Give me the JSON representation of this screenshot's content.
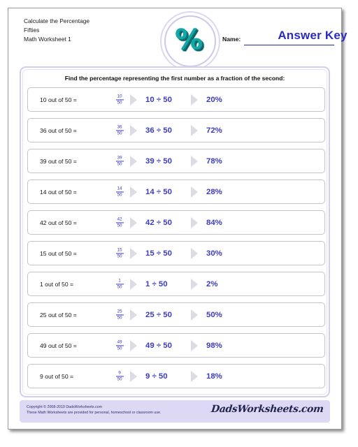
{
  "header": {
    "title_lines": [
      "Calculate the Percentage",
      "Fifties",
      "Math Worksheet 1"
    ],
    "logo_symbol": "%",
    "name_label": "Name:",
    "name_value": "Answer Key"
  },
  "worksheet": {
    "instructions": "Find the percentage representing the first number as a fraction of the second:",
    "problems": [
      {
        "prompt": "10 out of 50 =",
        "numerator": "10",
        "denominator": "50",
        "expression": "10 ÷ 50",
        "answer": "20%"
      },
      {
        "prompt": "36 out of 50 =",
        "numerator": "36",
        "denominator": "50",
        "expression": "36 ÷ 50",
        "answer": "72%"
      },
      {
        "prompt": "39 out of 50 =",
        "numerator": "39",
        "denominator": "50",
        "expression": "39 ÷ 50",
        "answer": "78%"
      },
      {
        "prompt": "14 out of 50 =",
        "numerator": "14",
        "denominator": "50",
        "expression": "14 ÷ 50",
        "answer": "28%"
      },
      {
        "prompt": "42 out of 50 =",
        "numerator": "42",
        "denominator": "50",
        "expression": "42 ÷ 50",
        "answer": "84%"
      },
      {
        "prompt": "15 out of 50 =",
        "numerator": "15",
        "denominator": "50",
        "expression": "15 ÷ 50",
        "answer": "30%"
      },
      {
        "prompt": "1 out of 50 =",
        "numerator": "1",
        "denominator": "50",
        "expression": "1 ÷ 50",
        "answer": "2%"
      },
      {
        "prompt": "25 out of 50 =",
        "numerator": "25",
        "denominator": "50",
        "expression": "25 ÷ 50",
        "answer": "50%"
      },
      {
        "prompt": "49 out of 50 =",
        "numerator": "49",
        "denominator": "50",
        "expression": "49 ÷ 50",
        "answer": "98%"
      },
      {
        "prompt": "9 out of 50 =",
        "numerator": "9",
        "denominator": "50",
        "expression": "9 ÷ 50",
        "answer": "18%"
      }
    ]
  },
  "footer": {
    "copyright_line1": "Copyright © 2008-2019 DadsWorksheets.com",
    "copyright_line2": "These Math Worksheets are provided for personal, homeschool or classroom use.",
    "brand": "DadsWorksheets.com"
  },
  "colors": {
    "answer_blue": "#3b3bbf",
    "name_blue": "#2b2bc4",
    "panel_border": "#d3cdef",
    "footer_bg": "#ddd9f5",
    "logo_teal": "#13a8a8",
    "arrow_gray": "#dcdce4"
  }
}
